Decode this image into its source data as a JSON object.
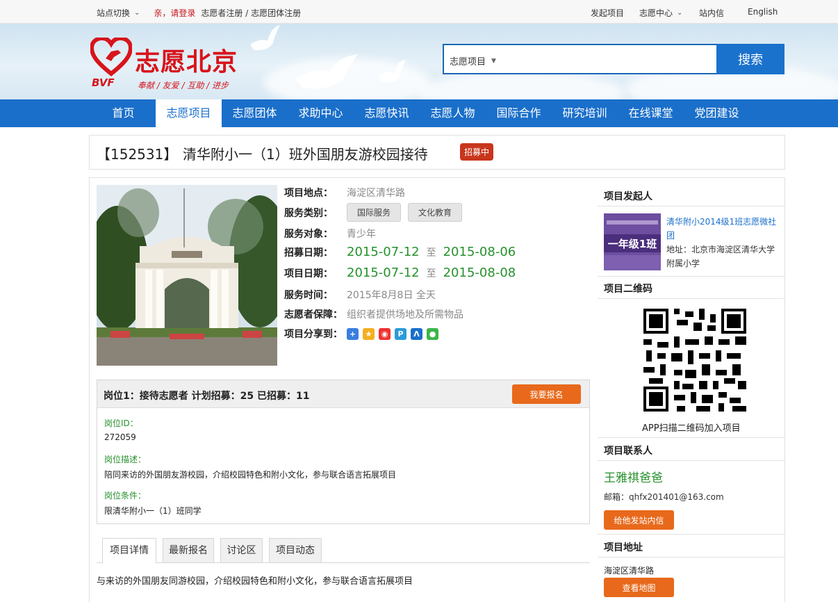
{
  "topbar": {
    "site_switch": "站点切换",
    "login": "亲，请登录",
    "register": "志愿者注册 / 志愿团体注册",
    "launch_project": "发起项目",
    "volunteer_center": "志愿中心",
    "messages": "站内信",
    "english": "English"
  },
  "logo": {
    "title": "志愿北京",
    "abbr": "BVF",
    "slogan": "奉献 / 友爱 / 互助 / 进步"
  },
  "search": {
    "type": "志愿项目",
    "button": "搜索",
    "placeholder": ""
  },
  "nav": {
    "items": [
      "首页",
      "志愿项目",
      "志愿团体",
      "求助中心",
      "志愿快讯",
      "志愿人物",
      "国际合作",
      "研究培训",
      "在线课堂",
      "党团建设"
    ],
    "active": "志愿项目"
  },
  "project": {
    "id": "【152531】",
    "title": "清华附小一（1）班外国朋友游校园接待",
    "status": "招募中",
    "location_label": "项目地点：",
    "location": "海淀区清华路",
    "category_label": "服务类别：",
    "categories": [
      "国际服务",
      "文化教育"
    ],
    "target_label": "服务对象：",
    "target": "青少年",
    "recruit_label": "招募日期：",
    "recruit_start": "2015-07-12",
    "recruit_end": "2015-08-06",
    "project_date_label": "项目日期：",
    "project_start": "2015-07-12",
    "project_end": "2015-08-08",
    "to": "至",
    "service_time_label": "服务时间：",
    "service_time": "2015年8月8日 全天",
    "guarantee_label": "志愿者保障：",
    "guarantee": "组织者提供场地及所需物品",
    "share_label": "项目分享到："
  },
  "position": {
    "header": "岗位1：接待志愿者   计划招募：25   已招募：11",
    "signup": "我要报名",
    "id_label": "岗位ID：",
    "id": "272059",
    "desc_label": "岗位描述：",
    "desc": "陪同来访的外国朋友游校园，介绍校园特色和附小文化，参与联合语言拓展项目",
    "cond_label": "岗位条件：",
    "cond": "限清华附小一（1）班同学"
  },
  "tabs": [
    "项目详情",
    "最新报名",
    "讨论区",
    "项目动态"
  ],
  "detail": "与来访的外国朋友同游校园，介绍校园特色和附小文化，参与联合语言拓展项目",
  "sidebar": {
    "initiator_title": "项目发起人",
    "org_name": "清华附小2014级1班志愿微社团",
    "org_addr": "地址：北京市海淀区清华大学附属小学",
    "org_img_text": "一年级1班",
    "qr_title": "项目二维码",
    "qr_caption": "APP扫描二维码加入项目",
    "contact_title": "项目联系人",
    "contact_name": "王雅祺爸爸",
    "contact_mail": "邮箱：qhfx201401@163.com",
    "message_btn": "给他发站内信",
    "address_title": "项目地址",
    "address": "海淀区清华路",
    "map_btn": "查看地图"
  },
  "colors": {
    "brand_red": "#d7141c",
    "nav_blue": "#1a6fca",
    "green": "#27912c",
    "orange": "#e8691b"
  }
}
